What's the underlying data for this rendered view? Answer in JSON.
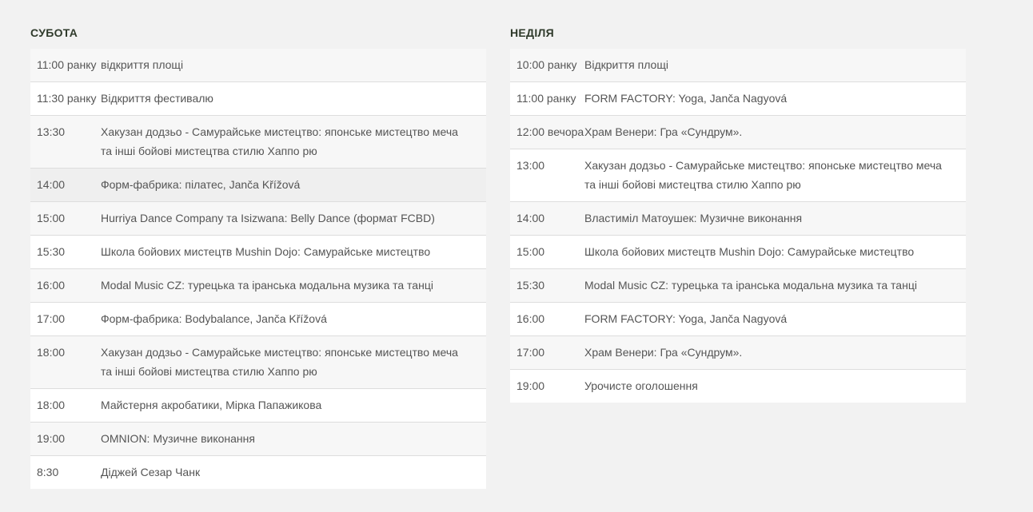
{
  "saturday": {
    "title": "СУБОТА",
    "rows": [
      {
        "time": "11:00 ранку",
        "event": "відкриття площі"
      },
      {
        "time": "11:30 ранку",
        "event": "Відкриття фестивалю"
      },
      {
        "time": "13:30",
        "event": "Хакузан додзьо - Самурайське мистецтво: японське мистецтво меча та інші бойові мистецтва стилю Хаппо рю"
      },
      {
        "time": "14:00",
        "event": "Форм-фабрика: пілатес, Janča Křížová"
      },
      {
        "time": "15:00",
        "event": "Hurriya Dance Company та Isizwana: Belly Dance (формат FCBD)"
      },
      {
        "time": "15:30",
        "event": "Школа бойових мистецтв Mushin Dojo: Самурайське мистецтво"
      },
      {
        "time": "16:00",
        "event": "Modal Music CZ: турецька та іранська модальна музика та танці"
      },
      {
        "time": "17:00",
        "event": "Форм-фабрика: Bodybalance, Janča Křížová"
      },
      {
        "time": "18:00",
        "event": "Хакузан додзьо - Самурайське мистецтво: японське мистецтво меча та інші бойові мистецтва стилю Хаппо рю"
      },
      {
        "time": "18:00",
        "event": "Майстерня акробатики, Мірка Папажикова"
      },
      {
        "time": "19:00",
        "event": "OMNION: Музичне виконання"
      },
      {
        "time": "8:30",
        "event": "Діджей Сезар Чанк"
      }
    ]
  },
  "sunday": {
    "title": "НЕДІЛЯ",
    "rows": [
      {
        "time": "10:00 ранку",
        "event": "Відкриття площі"
      },
      {
        "time": "11:00 ранку",
        "event": "FORM FACTORY: Yoga, Janča Nagyová"
      },
      {
        "time": "12:00 вечора",
        "event": "Храм Венери: Гра «Сундрум»."
      },
      {
        "time": "13:00",
        "event": "Хакузан додзьо - Самурайське мистецтво: японське мистецтво меча та інші бойові мистецтва стилю Хаппо рю"
      },
      {
        "time": "14:00",
        "event": "Властиміл Матоушек: Музичне виконання"
      },
      {
        "time": "15:00",
        "event": "Школа бойових мистецтв Mushin Dojo: Самурайське мистецтво"
      },
      {
        "time": "15:30",
        "event": "Modal Music CZ: турецька та іранська модальна музика та танці"
      },
      {
        "time": "16:00",
        "event": "FORM FACTORY: Yoga, Janča Nagyová"
      },
      {
        "time": "17:00",
        "event": "Храм Венери: Гра «Сундрум»."
      },
      {
        "time": "19:00",
        "event": "Урочисте оголошення"
      }
    ]
  }
}
